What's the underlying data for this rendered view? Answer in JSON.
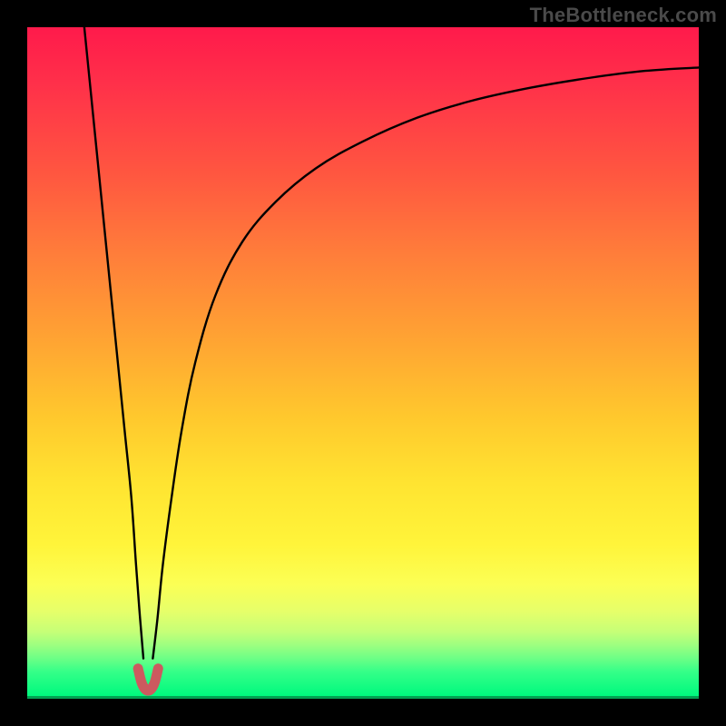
{
  "watermark": "TheBottleneck.com",
  "chart_data": {
    "type": "line",
    "title": "",
    "xlabel": "",
    "ylabel": "",
    "xlim": [
      0,
      100
    ],
    "ylim": [
      0,
      100
    ],
    "grid": false,
    "legend": false,
    "series": [
      {
        "name": "left-branch",
        "x": [
          8.5,
          9.5,
          10.5,
          11.5,
          12.5,
          13.5,
          14.5,
          15.5,
          16.2,
          16.8,
          17.3
        ],
        "y": [
          100,
          90,
          80,
          70,
          60,
          50,
          40,
          30,
          20,
          12,
          6
        ]
      },
      {
        "name": "right-branch",
        "x": [
          18.7,
          19.4,
          20.2,
          21.5,
          23,
          25,
          28,
          32,
          37,
          43,
          50,
          58,
          66,
          75,
          84,
          92,
          100
        ],
        "y": [
          6,
          12,
          20,
          30,
          40,
          50,
          60,
          68,
          74,
          79,
          83,
          86.5,
          89,
          91,
          92.5,
          93.5,
          94
        ]
      },
      {
        "name": "cusp-marker",
        "x": [
          16.5,
          17.0,
          17.5,
          18.0,
          18.5,
          19.0,
          19.5
        ],
        "y": [
          4.5,
          2.5,
          1.5,
          1.2,
          1.5,
          2.5,
          4.5
        ]
      }
    ],
    "annotations": []
  },
  "colors": {
    "curve": "#000000",
    "marker": "#cc5a5f",
    "background_top": "#ff1a4b",
    "background_bottom": "#00e876"
  }
}
